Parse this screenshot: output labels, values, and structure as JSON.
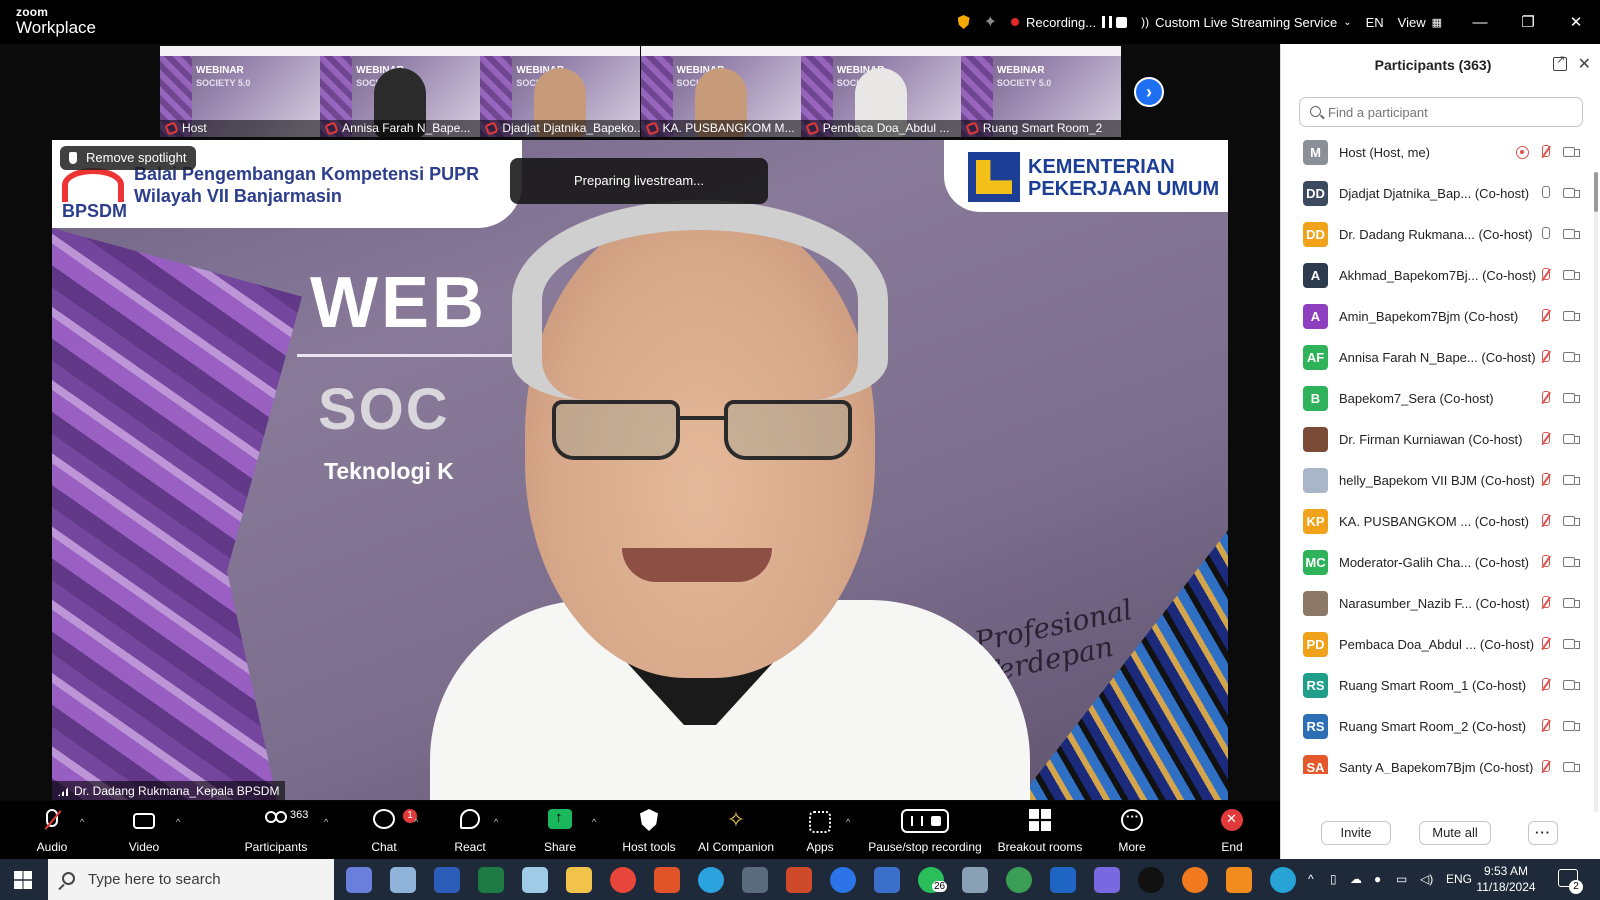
{
  "app": {
    "logo_line1": "zoom",
    "logo_line2": "Workplace",
    "recording_label": "Recording...",
    "live_stream_label": "Custom Live Streaming Service",
    "language": "EN",
    "view_label": "View"
  },
  "thumbnails": [
    {
      "name": "Host",
      "avatar": "slide"
    },
    {
      "name": "Annisa Farah N_Bape...",
      "avatar": "dark"
    },
    {
      "name": "Djadjat Djatnika_Bapeko...",
      "avatar": "skin"
    },
    {
      "name": "KA. PUSBANGKOM M...",
      "avatar": "skin"
    },
    {
      "name": "Pembaca Doa_Abdul ...",
      "avatar": "white"
    },
    {
      "name": "Ruang Smart Room_2",
      "avatar": "slide"
    }
  ],
  "thumb_slide": {
    "web": "WEBINAR",
    "soc": "SOCIETY 5.0"
  },
  "main_video": {
    "spotlight_label": "Remove spotlight",
    "toast": "Preparing livestream...",
    "speaker_name": "Dr. Dadang Rukmana_Kepala BPSDM",
    "banner_line1": "Balai Pengembangan Kompetensi PUPR",
    "banner_line2": "Wilayah VII Banjarmasin",
    "banner_line3": "BPSDM",
    "ministry_line1": "KEMENTERIAN",
    "ministry_line2": "PEKERJAAN UMUM",
    "slide_word1": "WEB",
    "slide_word2": "SOC",
    "slide_word3": "Teknologi K",
    "slide_script": "Profesional\nTerdepan"
  },
  "participants_panel": {
    "title": "Participants (363)",
    "search_placeholder": "Find a participant",
    "invite_label": "Invite",
    "mute_all_label": "Mute all",
    "more_label": "···",
    "participants": [
      {
        "initials": "M",
        "name": "Host (Host, me)",
        "color": "#8a8f98",
        "mic": "off",
        "recording": true
      },
      {
        "initials": "DD",
        "name": "Djadjat Djatnika_Bap...   (Co-host)",
        "color": "#3b4a5e",
        "mic": "on"
      },
      {
        "initials": "DD",
        "name": "Dr. Dadang Rukmana...  (Co-host)",
        "color": "#f0a21a",
        "mic": "on"
      },
      {
        "initials": "A",
        "name": "Akhmad_Bapekom7Bj...  (Co-host)",
        "color": "#2c3a4e",
        "mic": "off"
      },
      {
        "initials": "A",
        "name": "Amin_Bapekom7Bjm (Co-host)",
        "color": "#8e3fbf",
        "mic": "off"
      },
      {
        "initials": "AF",
        "name": "Annisa Farah N_Bape...  (Co-host)",
        "color": "#2fb35a",
        "mic": "off"
      },
      {
        "initials": "B",
        "name": "Bapekom7_Sera (Co-host)",
        "color": "#2fb35a",
        "mic": "off"
      },
      {
        "initials": "",
        "name": "Dr. Firman Kurniawan (Co-host)",
        "color": "#7a4b36",
        "mic": "off"
      },
      {
        "initials": "",
        "name": "helly_Bapekom VII BJM (Co-host)",
        "color": "#a9b6c9",
        "mic": "off"
      },
      {
        "initials": "KP",
        "name": "KA. PUSBANGKOM ...    (Co-host)",
        "color": "#f0a21a",
        "mic": "off"
      },
      {
        "initials": "MC",
        "name": "Moderator-Galih Cha...  (Co-host)",
        "color": "#2fb35a",
        "mic": "off"
      },
      {
        "initials": "",
        "name": "Narasumber_Nazib F...  (Co-host)",
        "color": "#8b7866",
        "mic": "off"
      },
      {
        "initials": "PD",
        "name": "Pembaca Doa_Abdul ...  (Co-host)",
        "color": "#f0a21a",
        "mic": "off"
      },
      {
        "initials": "RS",
        "name": "Ruang Smart Room_1 (Co-host)",
        "color": "#1f9e8a",
        "mic": "off"
      },
      {
        "initials": "RS",
        "name": "Ruang Smart Room_2 (Co-host)",
        "color": "#2c6fb5",
        "mic": "off"
      },
      {
        "initials": "SA",
        "name": "Santy A_Bapekom7Bjm (Co-host)",
        "color": "#e4582b",
        "mic": "off"
      }
    ]
  },
  "toolbar": {
    "audio": "Audio",
    "video": "Video",
    "participants": "Participants",
    "participants_count": "363",
    "chat": "Chat",
    "chat_badge": "1",
    "react": "React",
    "share": "Share",
    "host_tools": "Host tools",
    "ai_companion": "AI Companion",
    "apps": "Apps",
    "pause_stop": "Pause/stop recording",
    "breakout": "Breakout rooms",
    "more": "More",
    "end": "End"
  },
  "taskbar": {
    "search_placeholder": "Type here to search",
    "whatsapp_badge": "26",
    "language": "ENG",
    "time": "9:53 AM",
    "date": "11/18/2024",
    "notifications": "2"
  },
  "colors": {
    "accent_blue": "#1f6ff2",
    "zoom_red": "#e23a3a",
    "share_green": "#19b85c"
  }
}
